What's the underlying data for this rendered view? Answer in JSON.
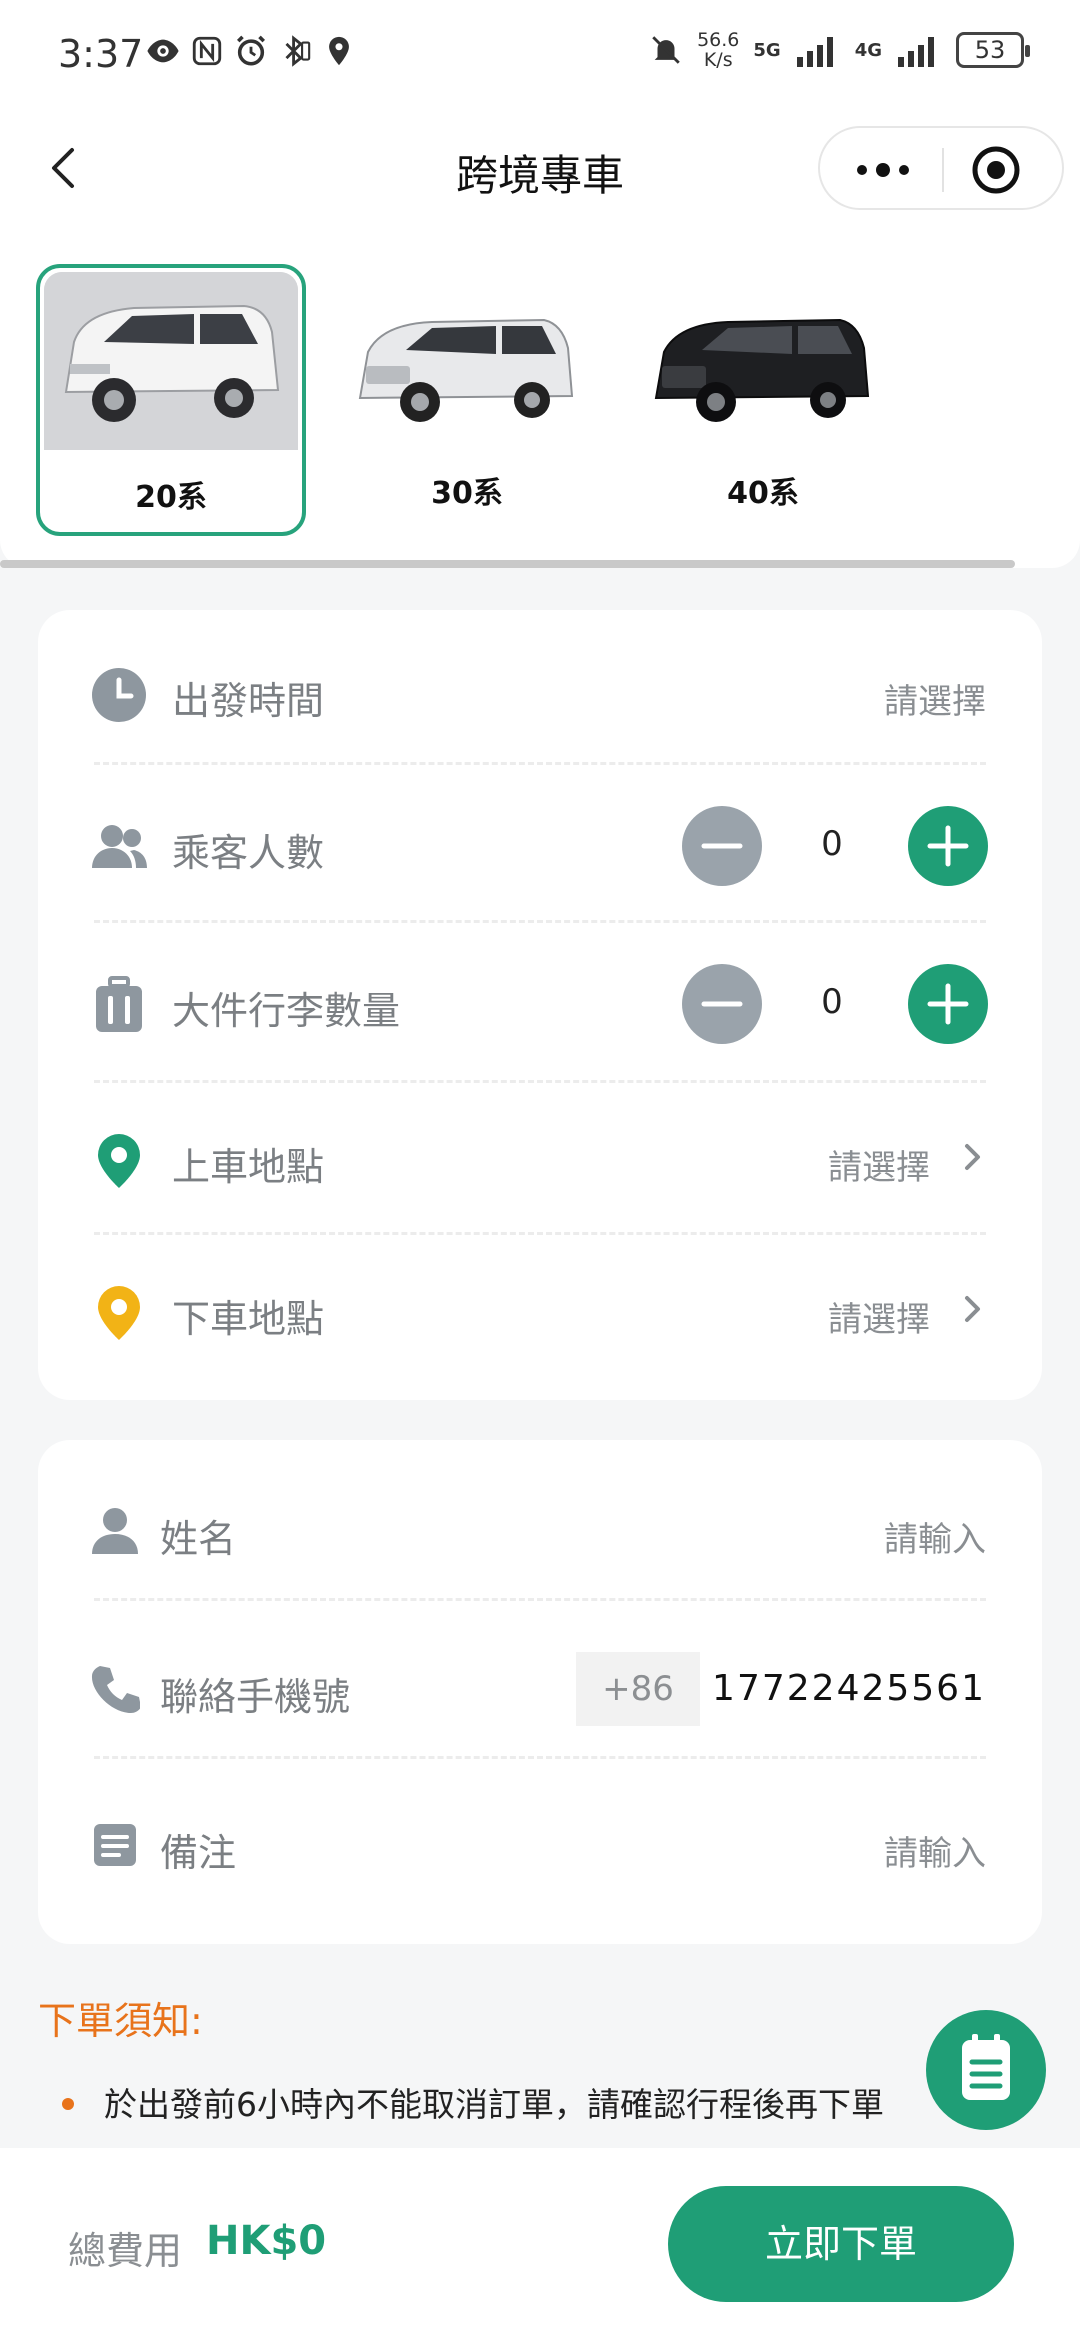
{
  "status_bar": {
    "time": "3:37",
    "net_speed_value": "56.6",
    "net_speed_unit": "K/s",
    "net_5g": "5G",
    "net_4g": "4G",
    "battery": "53"
  },
  "nav": {
    "title": "跨境專車"
  },
  "cars": [
    {
      "label": "20系",
      "selected": true
    },
    {
      "label": "30系",
      "selected": false
    },
    {
      "label": "40系",
      "selected": false
    }
  ],
  "trip_form": {
    "departure_time": {
      "label": "出發時間",
      "value": "請選擇"
    },
    "passengers": {
      "label": "乘客人數",
      "value": "0"
    },
    "luggage": {
      "label": "大件行李數量",
      "value": "0"
    },
    "pickup": {
      "label": "上車地點",
      "value": "請選擇"
    },
    "dropoff": {
      "label": "下車地點",
      "value": "請選擇"
    }
  },
  "contact_form": {
    "name": {
      "label": "姓名",
      "placeholder": "請輸入"
    },
    "phone": {
      "label": "聯絡手機號",
      "country_code": "+86",
      "value": "17722425561"
    },
    "remark": {
      "label": "備注",
      "placeholder": "請輸入"
    }
  },
  "notice": {
    "title": "下單須知:",
    "items": [
      "於出發前6小時內不能取消訂單，請確認行程後再下單"
    ]
  },
  "footer": {
    "total_label": "總費用",
    "total_amount": "HK$0",
    "submit_label": "立即下單"
  },
  "colors": {
    "accent": "#1f9e76",
    "selected_border": "#27a37c",
    "warning": "#e8731b",
    "minus_button": "#9aa3ab",
    "pickup_pin": "#1f9e76",
    "dropoff_pin": "#f2b316"
  },
  "icons": {
    "status_left": [
      "eye-icon",
      "nfc-icon",
      "alarm-icon",
      "bluetooth-icon",
      "location-icon"
    ],
    "status_right": [
      "mute-bell-icon",
      "signal-icon",
      "battery-icon"
    ]
  }
}
